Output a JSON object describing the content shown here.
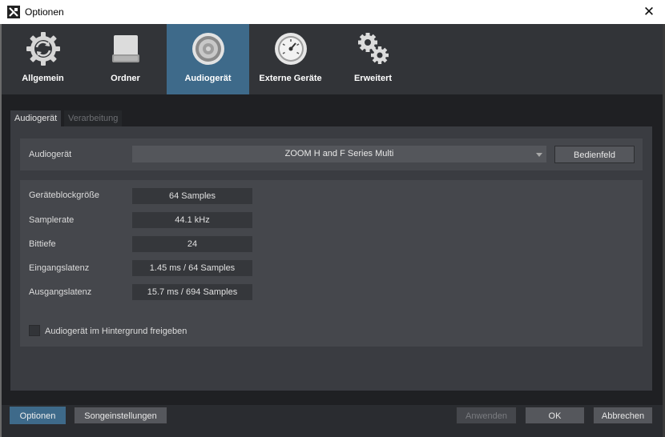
{
  "window": {
    "title": "Optionen",
    "close_glyph": "✕"
  },
  "nav": {
    "items": [
      {
        "label": "Allgemein",
        "icon": "sync-gear-icon"
      },
      {
        "label": "Ordner",
        "icon": "drive-icon"
      },
      {
        "label": "Audiogerät",
        "icon": "speaker-icon",
        "active": true
      },
      {
        "label": "Externe Geräte",
        "icon": "gauge-icon"
      },
      {
        "label": "Erweitert",
        "icon": "gears-icon"
      }
    ]
  },
  "tabs": [
    {
      "label": "Audiogerät",
      "active": true
    },
    {
      "label": "Verarbeitung",
      "active": false
    }
  ],
  "device": {
    "label": "Audiogerät",
    "selected": "ZOOM H and F Series Multi",
    "panel_button": "Bedienfeld"
  },
  "settings": [
    {
      "label": "Geräteblockgröße",
      "value": "64 Samples"
    },
    {
      "label": "Samplerate",
      "value": "44.1 kHz"
    },
    {
      "label": "Bittiefe",
      "value": "24"
    },
    {
      "label": "Eingangslatenz",
      "value": "1.45 ms / 64 Samples"
    },
    {
      "label": "Ausgangslatenz",
      "value": "15.7 ms / 694 Samples"
    }
  ],
  "background_release": {
    "label": "Audiogerät im Hintergrund freigeben",
    "checked": false
  },
  "footer": {
    "options": "Optionen",
    "song_settings": "Songeinstellungen",
    "apply": "Anwenden",
    "ok": "OK",
    "cancel": "Abbrechen"
  },
  "colors": {
    "accent": "#3e6a8a",
    "panel": "#3a3c41",
    "background": "#1f2023"
  }
}
